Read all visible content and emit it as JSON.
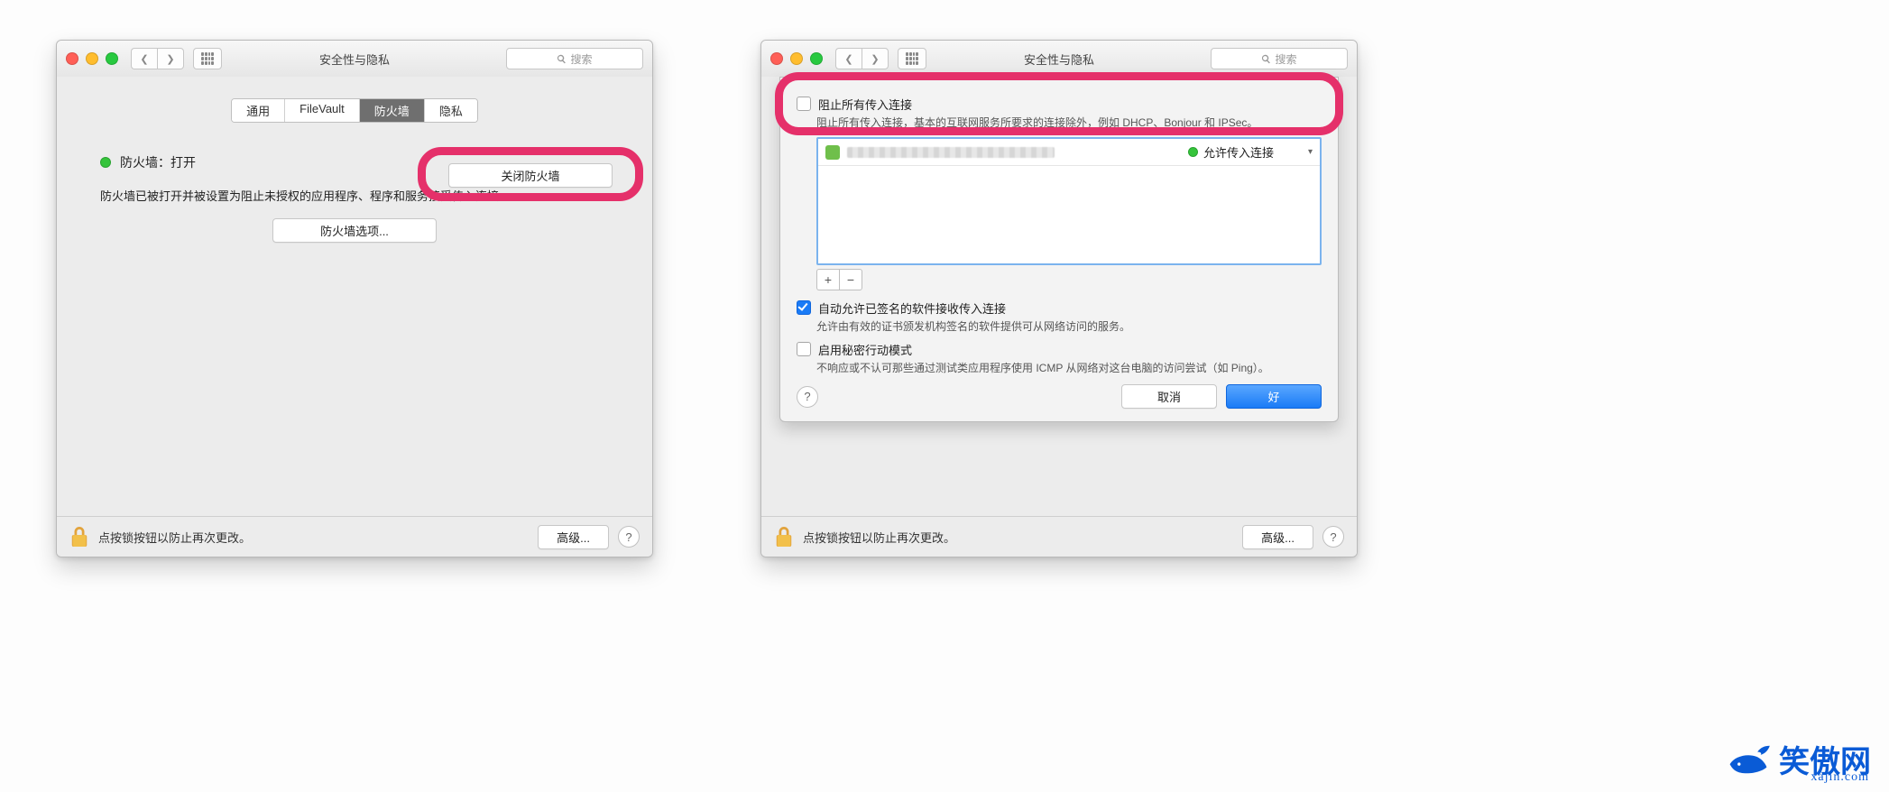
{
  "window_title": "安全性与隐私",
  "search_placeholder": "搜索",
  "tabs": {
    "general": "通用",
    "filevault": "FileVault",
    "firewall": "防火墙",
    "privacy": "隐私"
  },
  "left": {
    "status_label": "防火墙：打开",
    "turn_off_btn": "关闭防火墙",
    "desc": "防火墙已被打开并被设置为阻止未授权的应用程序、程序和服务接受传入连接。",
    "options_btn": "防火墙选项..."
  },
  "footer": {
    "lock_text": "点按锁按钮以防止再次更改。",
    "advanced_btn": "高级..."
  },
  "sheet": {
    "block_all_label": "阻止所有传入连接",
    "block_all_sub": "阻止所有传入连接，基本的互联网服务所要求的连接除外，例如 DHCP、Bonjour 和 IPSec。",
    "row_status": "允许传入连接",
    "auto_allow_label": "自动允许已签名的软件接收传入连接",
    "auto_allow_sub": "允许由有效的证书颁发机构签名的软件提供可从网络访问的服务。",
    "stealth_label": "启用秘密行动模式",
    "stealth_sub": "不响应或不认可那些通过测试类应用程序使用 ICMP 从网络对这台电脑的访问尝试（如 Ping）。",
    "cancel": "取消",
    "ok": "好"
  },
  "watermark": {
    "name": "笑傲网",
    "url": "xajin.com"
  }
}
